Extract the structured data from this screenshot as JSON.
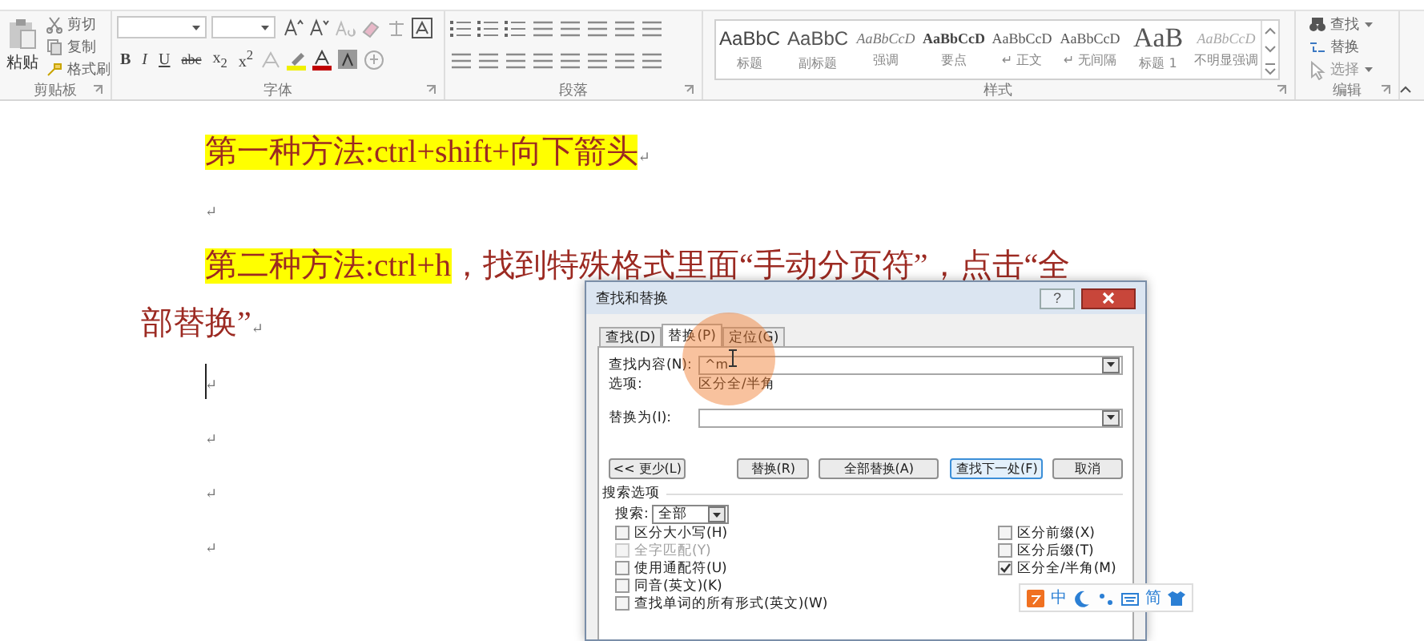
{
  "ribbon": {
    "clipboard": {
      "paste": "粘贴",
      "items": [
        "剪切",
        "复制",
        "格式刷"
      ],
      "label": "剪贴板"
    },
    "font": {
      "label": "字体",
      "format_buttons": [
        {
          "kind": "bold",
          "text": "B"
        },
        {
          "kind": "italic",
          "text": "I"
        },
        {
          "kind": "underline",
          "text": "U"
        },
        {
          "kind": "strike",
          "text": "abc"
        },
        {
          "kind": "sub",
          "text": "x$_{2}$"
        },
        {
          "kind": "sup",
          "text": "x$^{2}$"
        }
      ]
    },
    "paragraph": {
      "label": "段落"
    },
    "styles": {
      "label": "样式",
      "items": [
        {
          "kind": "title",
          "preview": "AaBbC",
          "name": "标题"
        },
        {
          "kind": "subtitle",
          "preview": "AaBbC",
          "name": "副标题"
        },
        {
          "kind": "emphasis",
          "preview": "AaBbCcD",
          "name": "强调"
        },
        {
          "kind": "strong",
          "preview": "AaBbCcD",
          "name": "要点"
        },
        {
          "kind": "normal",
          "preview": "AaBbCcD",
          "name": "↵ 正文"
        },
        {
          "kind": "normal",
          "preview": "AaBbCcD",
          "name": "↵ 无间隔"
        },
        {
          "kind": "heading",
          "preview": "AaB",
          "name": "标题 1"
        },
        {
          "kind": "subtle",
          "preview": "AaBbCcD",
          "name": "不明显强调"
        }
      ]
    },
    "editing": {
      "label": "编辑",
      "items": [
        {
          "label": "查找",
          "dropdown": true
        },
        {
          "label": "替换",
          "dropdown": false
        },
        {
          "label": "选择",
          "dropdown": true
        }
      ]
    }
  },
  "document": {
    "paragraphs": [
      {
        "kind": "text",
        "segments": [
          {
            "text": "第一种方法:ctrl+shift+向下箭头",
            "highlight": true
          }
        ],
        "mark": "↵"
      },
      {
        "kind": "empty",
        "mark": "↵",
        "cursor": false
      },
      {
        "kind": "text",
        "segments": [
          {
            "text": "第二种方法:ctrl+h",
            "highlight": true
          },
          {
            "text": "，找到特殊格式里面“手动分页符”，点击“全部替换”",
            "highlight": false
          }
        ],
        "mark": "↵"
      },
      {
        "kind": "empty",
        "mark": "↵",
        "cursor": true
      },
      {
        "kind": "empty",
        "mark": "↵",
        "cursor": false
      },
      {
        "kind": "empty",
        "mark": "↵",
        "cursor": false
      },
      {
        "kind": "empty",
        "mark": "↵",
        "cursor": false
      }
    ]
  },
  "dialog": {
    "title": "查找和替换",
    "help": "?",
    "tabs": [
      {
        "label": "查找(D)",
        "selected": false
      },
      {
        "label": "替换(P)",
        "selected": true
      },
      {
        "label": "定位(G)",
        "selected": false
      }
    ],
    "find_label": "查找内容(N):",
    "find_value": "^m",
    "options_label": "选项:",
    "options_value": "区分全/半角",
    "replace_label": "替换为(I):",
    "buttons": [
      "<< 更少(L)",
      "替换(R)",
      "全部替换(A)",
      "查找下一处(F)",
      "取消"
    ],
    "search_options_label": "搜索选项",
    "search_label": "搜索:",
    "search_value": "全部",
    "left_checks": [
      {
        "label": "区分大小写(H)",
        "checked": false,
        "disabled": false
      },
      {
        "label": "全字匹配(Y)",
        "checked": false,
        "disabled": true
      },
      {
        "label": "使用通配符(U)",
        "checked": false,
        "disabled": false
      },
      {
        "label": "同音(英文)(K)",
        "checked": false,
        "disabled": false
      },
      {
        "label": "查找单词的所有形式(英文)(W)",
        "checked": false,
        "disabled": false
      }
    ],
    "right_checks": [
      {
        "label": "区分前缀(X)",
        "checked": false,
        "disabled": false
      },
      {
        "label": "区分后缀(T)",
        "checked": false,
        "disabled": false
      },
      {
        "label": "区分全/半角(M)",
        "checked": true,
        "disabled": false
      }
    ]
  },
  "ime_toolbar": {
    "items": [
      {
        "kind": "logo"
      },
      {
        "kind": "text",
        "text": "中"
      },
      {
        "kind": "moon"
      },
      {
        "kind": "dots"
      },
      {
        "kind": "keyboard"
      },
      {
        "kind": "text",
        "text": "简"
      },
      {
        "kind": "shirt"
      }
    ]
  }
}
